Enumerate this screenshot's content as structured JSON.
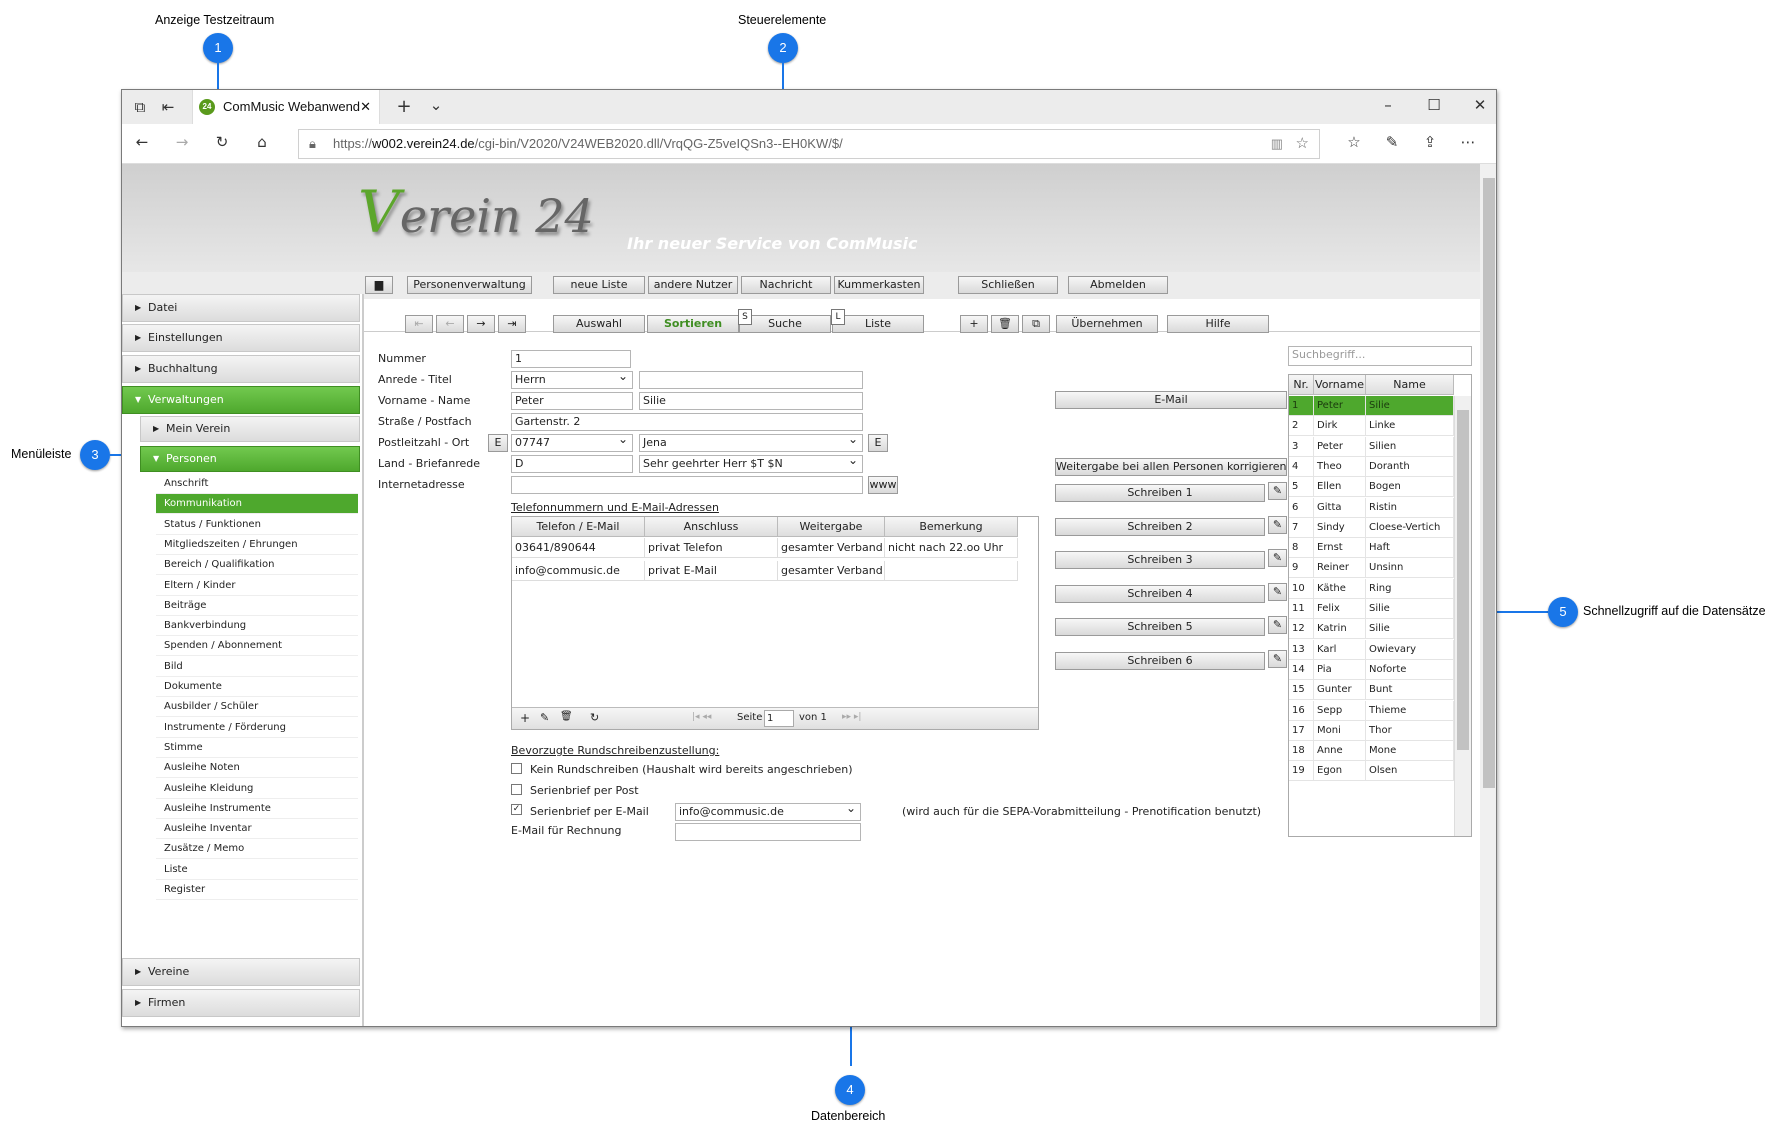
{
  "callouts": [
    {
      "number": "1",
      "label": "Anzeige Testzeitraum"
    },
    {
      "number": "2",
      "label": "Steuerelemente"
    },
    {
      "number": "3",
      "label": "Menüleiste"
    },
    {
      "number": "4",
      "label": "Datenbereich"
    },
    {
      "number": "5",
      "label": "Schnellzugriff auf die Datensätze"
    }
  ],
  "browser": {
    "tab_title": "ComMusic Webanwend",
    "favicon_text": "24",
    "url_domain": "w002.verein24.de",
    "url_prefix": "https://",
    "url_path": "/cgi-bin/V2020/V24WEB2020.dll/VrqQG-Z5veIQSn3--EH0KW/$/"
  },
  "header": {
    "logo": "Verein 24",
    "tagline": "Ihr neuer Service von ComMusic"
  },
  "top_buttons": [
    "Personenverwaltung",
    "neue Liste",
    "andere Nutzer",
    "Nachricht",
    "Kummerkasten",
    "Schließen",
    "Abmelden"
  ],
  "toolbar": {
    "auswahl": "Auswahl",
    "sortieren": "Sortieren",
    "suche": "Suche",
    "liste": "Liste",
    "uebernehmen": "Übernehmen",
    "hilfe": "Hilfe",
    "badge_s": "S",
    "badge_l": "L"
  },
  "sidebar": {
    "datei": "Datei",
    "einstellungen": "Einstellungen",
    "buchhaltung": "Buchhaltung",
    "verwaltungen": "Verwaltungen",
    "mein_verein": "Mein Verein",
    "personen": "Personen",
    "vereine": "Vereine",
    "firmen": "Firmen",
    "items": [
      "Anschrift",
      "Kommunikation",
      "Status / Funktionen",
      "Mitgliedszeiten / Ehrungen",
      "Bereich / Qualifikation",
      "Eltern / Kinder",
      "Beiträge",
      "Bankverbindung",
      "Spenden / Abonnement",
      "Bild",
      "Dokumente",
      "Ausbilder / Schüler",
      "Instrumente / Förderung",
      "Stimme",
      "Ausleihe Noten",
      "Ausleihe Kleidung",
      "Ausleihe Instrumente",
      "Ausleihe Inventar",
      "Zusätze / Memo",
      "Liste",
      "Register"
    ]
  },
  "form": {
    "labels": {
      "nummer": "Nummer",
      "anrede": "Anrede - Titel",
      "vorname": "Vorname - Name",
      "strasse": "Straße / Postfach",
      "plz": "Postleitzahl - Ort",
      "land": "Land - Briefanrede",
      "internet": "Internetadresse"
    },
    "values": {
      "nummer": "1",
      "anrede": "Herrn",
      "titel": "",
      "vorname": "Peter",
      "name": "Silie",
      "strasse": "Gartenstr. 2",
      "plz": "07747",
      "ort": "Jena",
      "land": "D",
      "briefanrede": "Sehr geehrter Herr $T $N",
      "internet": ""
    },
    "e_btn": "E",
    "www_btn": "www"
  },
  "right_buttons": {
    "email": "E-Mail",
    "weitergabe": "Weitergabe bei allen Personen korrigieren",
    "schreiben": [
      "Schreiben 1",
      "Schreiben 2",
      "Schreiben 3",
      "Schreiben 4",
      "Schreiben 5",
      "Schreiben 6"
    ]
  },
  "phones": {
    "title": "Telefonnummern und E-Mail-Adressen",
    "headers": [
      "Telefon / E-Mail",
      "Anschluss",
      "Weitergabe",
      "Bemerkung"
    ],
    "rows": [
      [
        "03641/890644",
        "privat Telefon",
        "gesamter Verband",
        "nicht nach 22.oo Uhr"
      ],
      [
        "info@commusic.de",
        "privat E-Mail",
        "gesamter Verband",
        ""
      ]
    ],
    "pager": {
      "seite": "Seite",
      "page": "1",
      "von": "von 1"
    }
  },
  "rundschreiben": {
    "title": "Bevorzugte Rundschreibenzustellung:",
    "options": [
      {
        "label": "Kein Rundschreiben (Haushalt wird bereits angeschrieben)",
        "checked": false
      },
      {
        "label": "Serienbrief per Post",
        "checked": false
      },
      {
        "label": "Serienbrief per E-Mail",
        "checked": true
      }
    ],
    "email_value": "info@commusic.de",
    "note": "(wird auch für die SEPA-Vorabmitteilung - Prenotification benutzt)",
    "rechnung_label": "E-Mail für Rechnung"
  },
  "quick": {
    "search_placeholder": "Suchbegriff...",
    "headers": [
      "Nr.",
      "Vorname",
      "Name"
    ],
    "rows": [
      [
        "1",
        "Peter",
        "Silie"
      ],
      [
        "2",
        "Dirk",
        "Linke"
      ],
      [
        "3",
        "Peter",
        "Silien"
      ],
      [
        "4",
        "Theo",
        "Doranth"
      ],
      [
        "5",
        "Ellen",
        "Bogen"
      ],
      [
        "6",
        "Gitta",
        "Ristin"
      ],
      [
        "7",
        "Sindy",
        "Cloese-Vertich"
      ],
      [
        "8",
        "Ernst",
        "Haft"
      ],
      [
        "9",
        "Reiner",
        "Unsinn"
      ],
      [
        "10",
        "Käthe",
        "Ring"
      ],
      [
        "11",
        "Felix",
        "Silie"
      ],
      [
        "12",
        "Katrin",
        "Silie"
      ],
      [
        "13",
        "Karl",
        "Owievary"
      ],
      [
        "14",
        "Pia",
        "Noforte"
      ],
      [
        "15",
        "Gunter",
        "Bunt"
      ],
      [
        "16",
        "Sepp",
        "Thieme"
      ],
      [
        "17",
        "Moni",
        "Thor"
      ],
      [
        "18",
        "Anne",
        "Mone"
      ],
      [
        "19",
        "Egon",
        "Olsen"
      ]
    ]
  }
}
